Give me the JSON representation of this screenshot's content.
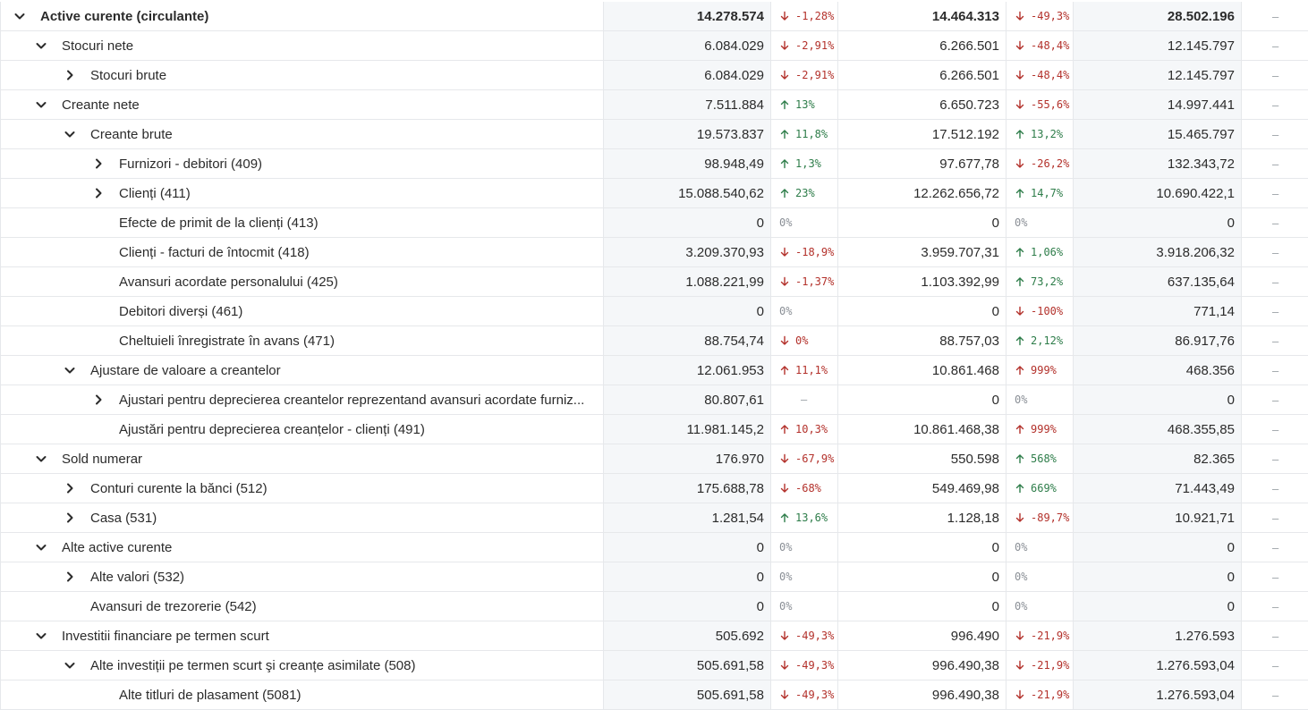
{
  "rows": [
    {
      "name": "Active curente (circulante)",
      "level": 0,
      "chevron": "down",
      "bold": true,
      "v1": "14.278.574",
      "p1": "-1,28%",
      "d1": "down",
      "v2": "14.464.313",
      "p2": "-49,3%",
      "d2": "down",
      "v3": "28.502.196",
      "last": "–"
    },
    {
      "name": "Stocuri nete",
      "level": 1,
      "chevron": "down",
      "v1": "6.084.029",
      "p1": "-2,91%",
      "d1": "down",
      "v2": "6.266.501",
      "p2": "-48,4%",
      "d2": "down",
      "v3": "12.145.797",
      "last": "–"
    },
    {
      "name": "Stocuri brute",
      "level": 2,
      "chevron": "right",
      "v1": "6.084.029",
      "p1": "-2,91%",
      "d1": "down",
      "v2": "6.266.501",
      "p2": "-48,4%",
      "d2": "down",
      "v3": "12.145.797",
      "last": "–"
    },
    {
      "name": "Creante nete",
      "level": 1,
      "chevron": "down",
      "v1": "7.511.884",
      "p1": "13%",
      "d1": "up",
      "v2": "6.650.723",
      "p2": "-55,6%",
      "d2": "down",
      "v3": "14.997.441",
      "last": "–"
    },
    {
      "name": "Creante brute",
      "level": 2,
      "chevron": "down",
      "v1": "19.573.837",
      "p1": "11,8%",
      "d1": "up",
      "v2": "17.512.192",
      "p2": "13,2%",
      "d2": "up",
      "v3": "15.465.797",
      "last": "–"
    },
    {
      "name": "Furnizori - debitori (409)",
      "level": 3,
      "chevron": "right",
      "v1": "98.948,49",
      "p1": "1,3%",
      "d1": "up",
      "v2": "97.677,78",
      "p2": "-26,2%",
      "d2": "down",
      "v3": "132.343,72",
      "last": "–"
    },
    {
      "name": "Clienți (411)",
      "level": 3,
      "chevron": "right",
      "v1": "15.088.540,62",
      "p1": "23%",
      "d1": "up",
      "v2": "12.262.656,72",
      "p2": "14,7%",
      "d2": "up",
      "v3": "10.690.422,1",
      "last": "–"
    },
    {
      "name": "Efecte de primit de la clienți (413)",
      "level": 3,
      "chevron": "none",
      "v1": "0",
      "p1": "0%",
      "d1": "neutral",
      "v2": "0",
      "p2": "0%",
      "d2": "neutral",
      "v3": "0",
      "last": "–"
    },
    {
      "name": "Clienți - facturi de întocmit (418)",
      "level": 3,
      "chevron": "none",
      "v1": "3.209.370,93",
      "p1": "-18,9%",
      "d1": "down",
      "v2": "3.959.707,31",
      "p2": "1,06%",
      "d2": "up",
      "v3": "3.918.206,32",
      "last": "–"
    },
    {
      "name": "Avansuri acordate personalului (425)",
      "level": 3,
      "chevron": "none",
      "v1": "1.088.221,99",
      "p1": "-1,37%",
      "d1": "down",
      "v2": "1.103.392,99",
      "p2": "73,2%",
      "d2": "up",
      "v3": "637.135,64",
      "last": "–"
    },
    {
      "name": "Debitori diverși (461)",
      "level": 3,
      "chevron": "none",
      "v1": "0",
      "p1": "0%",
      "d1": "neutral",
      "v2": "0",
      "p2": "-100%",
      "d2": "down",
      "v3": "771,14",
      "last": "–"
    },
    {
      "name": "Cheltuieli înregistrate în avans (471)",
      "level": 3,
      "chevron": "none",
      "v1": "88.754,74",
      "p1": "0%",
      "d1": "down",
      "v2": "88.757,03",
      "p2": "2,12%",
      "d2": "up",
      "v3": "86.917,76",
      "last": "–"
    },
    {
      "name": "Ajustare de valoare a creantelor",
      "level": 2,
      "chevron": "down",
      "v1": "12.061.953",
      "p1": "11,1%",
      "d1": "up-red",
      "v2": "10.861.468",
      "p2": "999%",
      "d2": "up-red",
      "v3": "468.356",
      "last": "–"
    },
    {
      "name": "Ajustari pentru deprecierea creantelor reprezentand avansuri acordate furniz...",
      "level": 3,
      "chevron": "right",
      "v1": "80.807,61",
      "p1": "–",
      "d1": "dash",
      "v2": "0",
      "p2": "0%",
      "d2": "neutral",
      "v3": "0",
      "last": "–"
    },
    {
      "name": "Ajustări pentru deprecierea creanțelor - clienți (491)",
      "level": 3,
      "chevron": "none",
      "v1": "11.981.145,2",
      "p1": "10,3%",
      "d1": "up-red",
      "v2": "10.861.468,38",
      "p2": "999%",
      "d2": "up-red",
      "v3": "468.355,85",
      "last": "–"
    },
    {
      "name": "Sold numerar",
      "level": 1,
      "chevron": "down",
      "v1": "176.970",
      "p1": "-67,9%",
      "d1": "down",
      "v2": "550.598",
      "p2": "568%",
      "d2": "up",
      "v3": "82.365",
      "last": "–"
    },
    {
      "name": "Conturi curente la bănci (512)",
      "level": 2,
      "chevron": "right",
      "v1": "175.688,78",
      "p1": "-68%",
      "d1": "down",
      "v2": "549.469,98",
      "p2": "669%",
      "d2": "up",
      "v3": "71.443,49",
      "last": "–"
    },
    {
      "name": "Casa (531)",
      "level": 2,
      "chevron": "right",
      "v1": "1.281,54",
      "p1": "13,6%",
      "d1": "up",
      "v2": "1.128,18",
      "p2": "-89,7%",
      "d2": "down",
      "v3": "10.921,71",
      "last": "–"
    },
    {
      "name": "Alte active curente",
      "level": 1,
      "chevron": "down",
      "v1": "0",
      "p1": "0%",
      "d1": "neutral",
      "v2": "0",
      "p2": "0%",
      "d2": "neutral",
      "v3": "0",
      "last": "–"
    },
    {
      "name": "Alte valori (532)",
      "level": 2,
      "chevron": "right",
      "v1": "0",
      "p1": "0%",
      "d1": "neutral",
      "v2": "0",
      "p2": "0%",
      "d2": "neutral",
      "v3": "0",
      "last": "–"
    },
    {
      "name": "Avansuri de trezorerie (542)",
      "level": 2,
      "chevron": "none",
      "v1": "0",
      "p1": "0%",
      "d1": "neutral",
      "v2": "0",
      "p2": "0%",
      "d2": "neutral",
      "v3": "0",
      "last": "–"
    },
    {
      "name": "Investitii financiare pe termen scurt",
      "level": 1,
      "chevron": "down",
      "v1": "505.692",
      "p1": "-49,3%",
      "d1": "down",
      "v2": "996.490",
      "p2": "-21,9%",
      "d2": "down",
      "v3": "1.276.593",
      "last": "–"
    },
    {
      "name": "Alte investiții pe termen scurt şi creanțe asimilate (508)",
      "level": 2,
      "chevron": "down",
      "v1": "505.691,58",
      "p1": "-49,3%",
      "d1": "down",
      "v2": "996.490,38",
      "p2": "-21,9%",
      "d2": "down",
      "v3": "1.276.593,04",
      "last": "–"
    },
    {
      "name": "Alte titluri de plasament (5081)",
      "level": 3,
      "chevron": "none",
      "v1": "505.691,58",
      "p1": "-49,3%",
      "d1": "down",
      "v2": "996.490,38",
      "p2": "-21,9%",
      "d2": "down",
      "v3": "1.276.593,04",
      "last": "–"
    }
  ],
  "icons": {
    "expanded": "chevron-down-icon",
    "collapsed": "chevron-right-icon",
    "increase": "arrow-up-icon",
    "decrease": "arrow-down-icon"
  },
  "colors": {
    "increase": "#2e7d4a",
    "decrease": "#b3312b",
    "neutral": "#8a8f96",
    "highlight_column": "#f5f7f9",
    "border": "#e6e8eb"
  }
}
